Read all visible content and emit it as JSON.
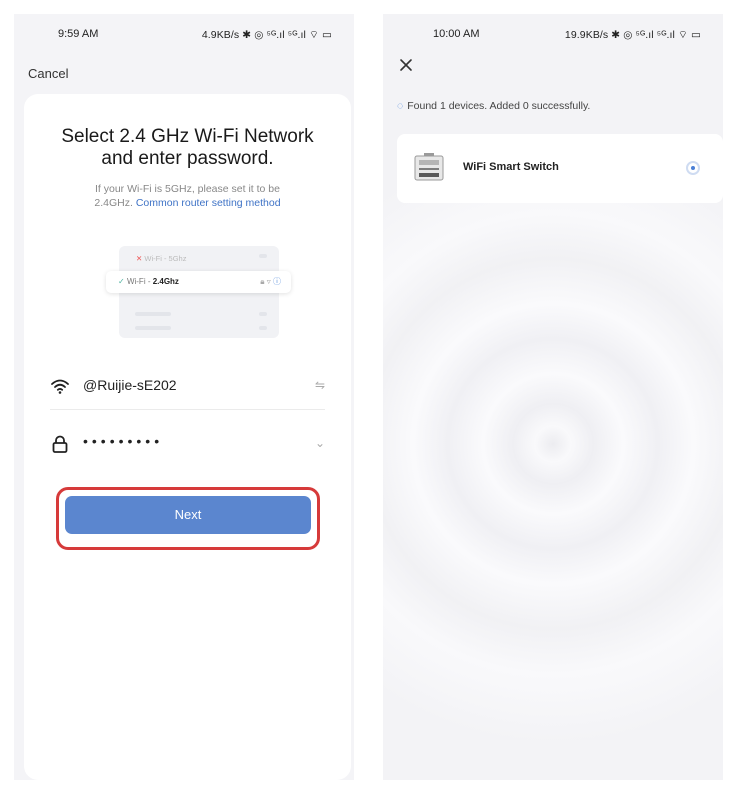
{
  "left": {
    "status": {
      "time": "9:59 AM",
      "sys": "4.9KB/s ✱ ◎ ⁵ᴳ.ıl ⁵ᴳ.ıl ⌔ ▭"
    },
    "cancel_label": "Cancel",
    "title_line1": "Select 2.4 GHz Wi-Fi Network",
    "title_line2": "and enter password.",
    "subtitle_line1": "If your Wi-Fi is 5GHz, please set it to be",
    "subtitle_prefix": "2.4GHz.",
    "subtitle_link": "Common router setting method",
    "illustration": {
      "row_5g_label": "Wi-Fi - 5Ghz",
      "row_24_prefix": "Wi-Fi - ",
      "row_24_bold": "2.4Ghz"
    },
    "ssid": "@Ruijie-sE202",
    "password_mask": "•••••••••",
    "next_label": "Next",
    "highlight_color": "#d63a3a",
    "accent_color": "#5b86cf"
  },
  "right": {
    "status": {
      "time": "10:00 AM",
      "sys": "19.9KB/s ✱ ◎ ⁵ᴳ.ıl ⁵ᴳ.ıl ⌔ ▭"
    },
    "found_text": "Found 1 devices. Added 0 successfully.",
    "device": {
      "name": "WiFi Smart Switch",
      "selected": true
    }
  },
  "icons": [
    "wifi-icon",
    "lock-icon",
    "swap-icon",
    "chevron-down-icon",
    "close-icon",
    "loading-icon",
    "radio-button",
    "device-thumbnail"
  ]
}
